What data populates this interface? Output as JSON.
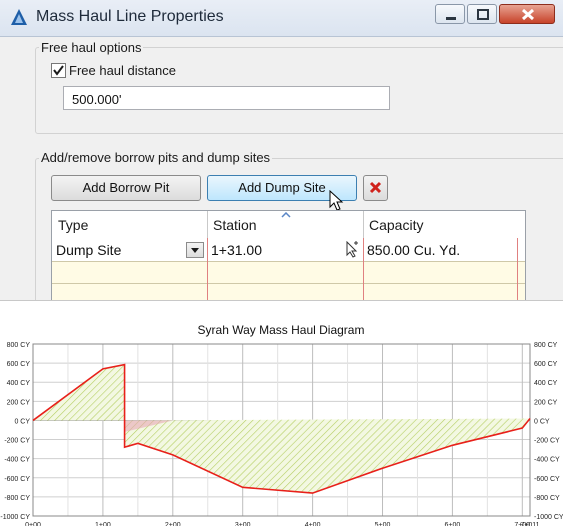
{
  "window": {
    "title": "Mass Haul Line Properties",
    "controls": {
      "minimize": "minimize",
      "maximize": "maximize",
      "close": "close"
    }
  },
  "free_haul": {
    "group_label": "Free haul options",
    "checkbox_label": "Free haul distance",
    "checked": true,
    "distance_value": "500.000'"
  },
  "sites": {
    "group_label": "Add/remove borrow pits and dump sites",
    "add_borrow_label": "Add Borrow Pit",
    "add_dump_label": "Add Dump Site",
    "delete_icon": "red-x-icon",
    "columns": [
      "Type",
      "Station",
      "Capacity"
    ],
    "rows": [
      {
        "type": "Dump Site",
        "station": "1+31.00",
        "capacity": "850.00 Cu. Yd."
      }
    ]
  },
  "chart_data": {
    "type": "line",
    "title": "Syrah Way Mass Haul Diagram",
    "xlabel": "",
    "ylabel": "",
    "x_tick_labels": [
      "0+00",
      "1+00",
      "2+00",
      "3+00",
      "4+00",
      "5+00",
      "6+00",
      "7+00",
      "7+011"
    ],
    "x_tick_values": [
      0,
      100,
      200,
      300,
      400,
      500,
      600,
      700,
      711
    ],
    "y_tick_labels_left": [
      "800 CY",
      "600 CY",
      "400 CY",
      "200 CY",
      "0 CY",
      "-200 CY",
      "-400 CY",
      "-600 CY",
      "-800 CY",
      "-1000 CY"
    ],
    "y_tick_labels_right": [
      "800 CY",
      "600 CY",
      "400 CY",
      "200 CY",
      "0 CY",
      "-200 CY",
      "-400 CY",
      "-600 CY",
      "-800 CY",
      "-1000 CY"
    ],
    "y_tick_values": [
      800,
      600,
      400,
      200,
      0,
      -200,
      -400,
      -600,
      -800,
      -1000
    ],
    "xlim": [
      0,
      711
    ],
    "ylim": [
      -1000,
      800
    ],
    "grid": true,
    "series": [
      {
        "color": "#e8201a",
        "x": [
          0,
          100,
          131,
          131,
          150,
          200,
          300,
          400,
          500,
          600,
          700,
          711
        ],
        "y": [
          0,
          540,
          585,
          -280,
          -240,
          -360,
          -700,
          -760,
          -500,
          -260,
          -80,
          20
        ]
      }
    ],
    "fill_colors": {
      "balance_hatch": "#b5cf63",
      "pink_region": "#e8a8b8"
    }
  }
}
